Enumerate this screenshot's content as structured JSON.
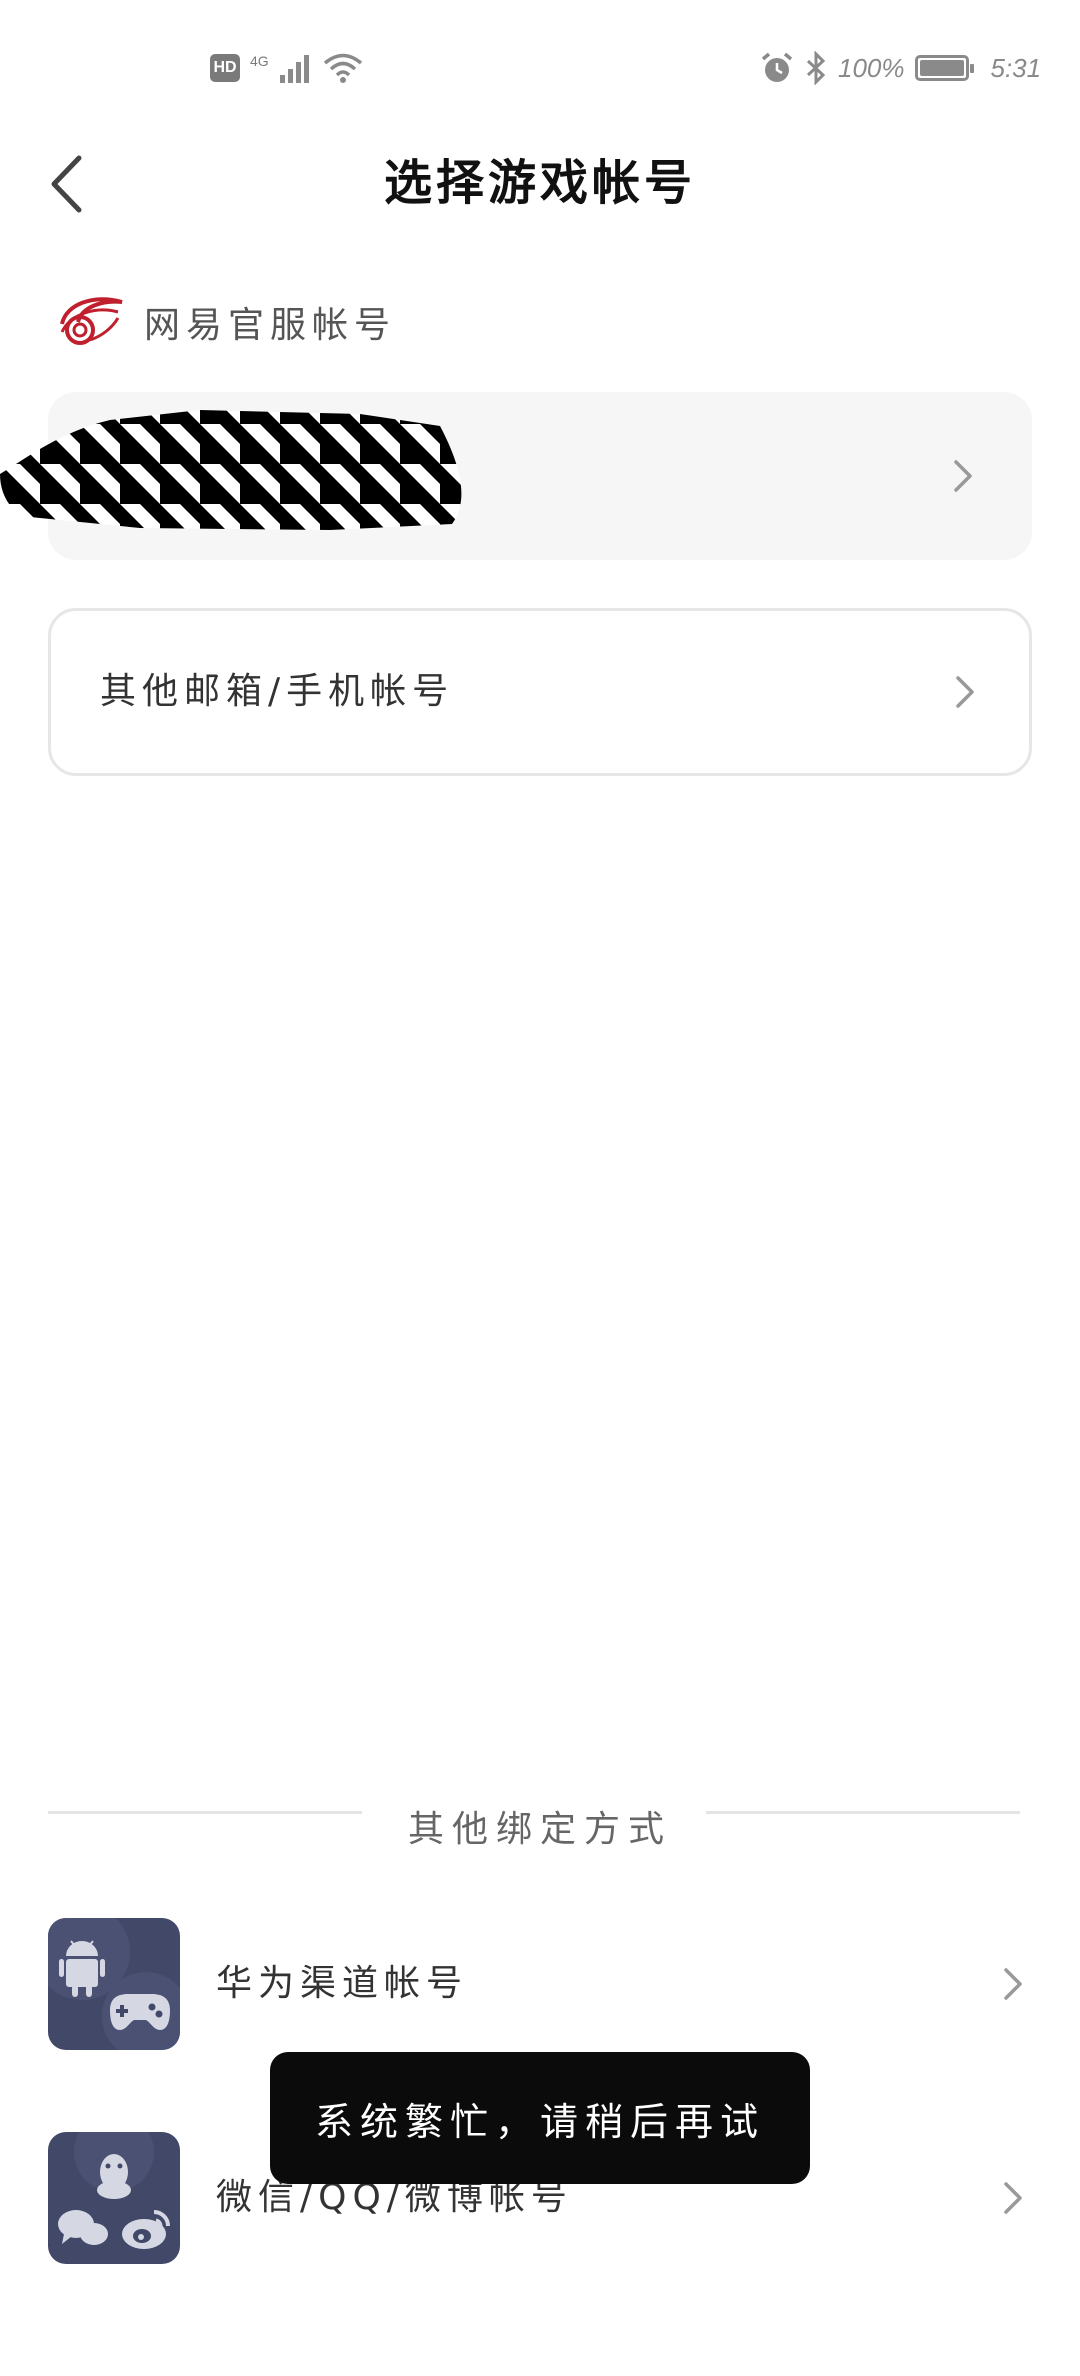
{
  "status_bar": {
    "hd_badge": "HD",
    "network_type": "4G",
    "battery_percent": "100%",
    "battery_level": 1.0,
    "time": "5:31",
    "icons": [
      "signal-icon",
      "wifi-icon",
      "alarm-icon",
      "bluetooth-icon",
      "battery-icon"
    ]
  },
  "header": {
    "title": "选择游戏帐号",
    "back_icon": "chevron-left-icon"
  },
  "netease_section": {
    "label": "网易官服帐号",
    "logo_icon": "netease-logo-icon"
  },
  "accounts": [
    {
      "label": "",
      "redacted": true
    }
  ],
  "other_account": {
    "label": "其他邮箱/手机帐号"
  },
  "divider": {
    "label": "其他绑定方式"
  },
  "bind_options": [
    {
      "label": "华为渠道帐号",
      "icons": [
        "android-icon",
        "gamepad-icon"
      ]
    },
    {
      "label": "微信/QQ/微博帐号",
      "icons": [
        "qq-penguin-icon",
        "wechat-icon",
        "weibo-icon"
      ]
    }
  ],
  "toast": {
    "message": "系统繁忙，请稍后再试"
  },
  "colors": {
    "card_bg": "#f6f6f6",
    "bind_icon_bg": "#424867",
    "toast_bg": "#0b0b0b",
    "netease_red": "#c0202e",
    "chevron": "#999999"
  }
}
